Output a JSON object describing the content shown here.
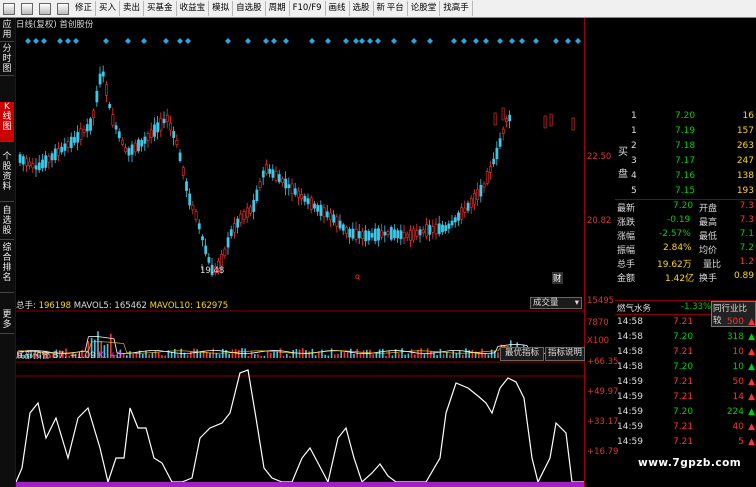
{
  "toolbar": {
    "items": [
      "修正",
      "买入",
      "卖出",
      "买基金",
      "收益宝",
      "模拟",
      "自选股",
      "周期",
      "F10/F9",
      "画线",
      "选股",
      "新 平台",
      "论股堂",
      "找高手"
    ]
  },
  "sidebar": {
    "items": [
      "应用",
      "分时图",
      "K线图",
      "个股资料",
      "自选股",
      "综合排名",
      "更多"
    ],
    "active_index": 2
  },
  "chart": {
    "header": "日线(复权) 首创股份",
    "price_axis": [
      "22.50",
      "20.82"
    ],
    "low_marker": "19.48",
    "event_markers": [
      "q",
      "财"
    ]
  },
  "volume": {
    "legend_label": "总手:",
    "legend_value": "196198",
    "ma5_label": "MAVOL5:",
    "ma5_value": "165462",
    "ma10_label": "MAVOL10:",
    "ma10_value": "162975",
    "dropdown": "成交量",
    "axis": [
      "15495",
      "7870",
      "X100"
    ]
  },
  "indicator": {
    "name": "底部预警",
    "b7_label": "B7: +1.09",
    "k_label": "K: +0",
    "btn_best": "最优指标",
    "btn_help": "指标说明",
    "axis": [
      "+66.35",
      "+49.97",
      "+33.17",
      "+16.79"
    ]
  },
  "quote": {
    "buy_label": [
      "买",
      "盘"
    ],
    "levels": [
      {
        "n": "1",
        "price": "7.20",
        "vol": "16"
      },
      {
        "n": "1",
        "price": "7.19",
        "vol": "157"
      },
      {
        "n": "2",
        "price": "7.18",
        "vol": "263"
      },
      {
        "n": "3",
        "price": "7.17",
        "vol": "247"
      },
      {
        "n": "4",
        "price": "7.16",
        "vol": "138"
      },
      {
        "n": "5",
        "price": "7.15",
        "vol": "193"
      }
    ],
    "stats": [
      {
        "l1": "最新",
        "v1": "7.20",
        "l2": "开盘",
        "v2": "7.3"
      },
      {
        "l1": "涨跌",
        "v1": "-0.19",
        "l2": "最高",
        "v2": "7.3"
      },
      {
        "l1": "涨幅",
        "v1": "-2.57%",
        "l2": "最低",
        "v2": "7.1"
      },
      {
        "l1": "振幅",
        "v1": "2.84%",
        "l2": "均价",
        "v2": "7.2"
      },
      {
        "l1": "总手",
        "v1": "19.62万",
        "l2": "量比",
        "v2": "1.2"
      },
      {
        "l1": "金额",
        "v1": "1.42亿",
        "l2": "换手",
        "v2": "0.89"
      }
    ]
  },
  "sector": {
    "name": "燃气水务",
    "change": "-1.33%",
    "button": "同行业比较"
  },
  "trades": [
    {
      "time": "14:58",
      "price": "7.21",
      "vol": "500"
    },
    {
      "time": "14:58",
      "price": "7.20",
      "vol": "318"
    },
    {
      "time": "14:58",
      "price": "7.21",
      "vol": "10"
    },
    {
      "time": "14:58",
      "price": "7.20",
      "vol": "10"
    },
    {
      "time": "14:59",
      "price": "7.21",
      "vol": "50"
    },
    {
      "time": "14:59",
      "price": "7.21",
      "vol": "14"
    },
    {
      "time": "14:59",
      "price": "7.20",
      "vol": "224"
    },
    {
      "time": "14:59",
      "price": "7.21",
      "vol": "40"
    },
    {
      "time": "14:59",
      "price": "7.21",
      "vol": "5"
    }
  ],
  "watermark": "www.7gpzb.com",
  "colors": {
    "up": "#ff3030",
    "down": "#3cc8e8",
    "neutral": "#f0f0f0",
    "accent_red": "#cc0000",
    "yellow": "#ffd700",
    "green": "#00d000"
  }
}
